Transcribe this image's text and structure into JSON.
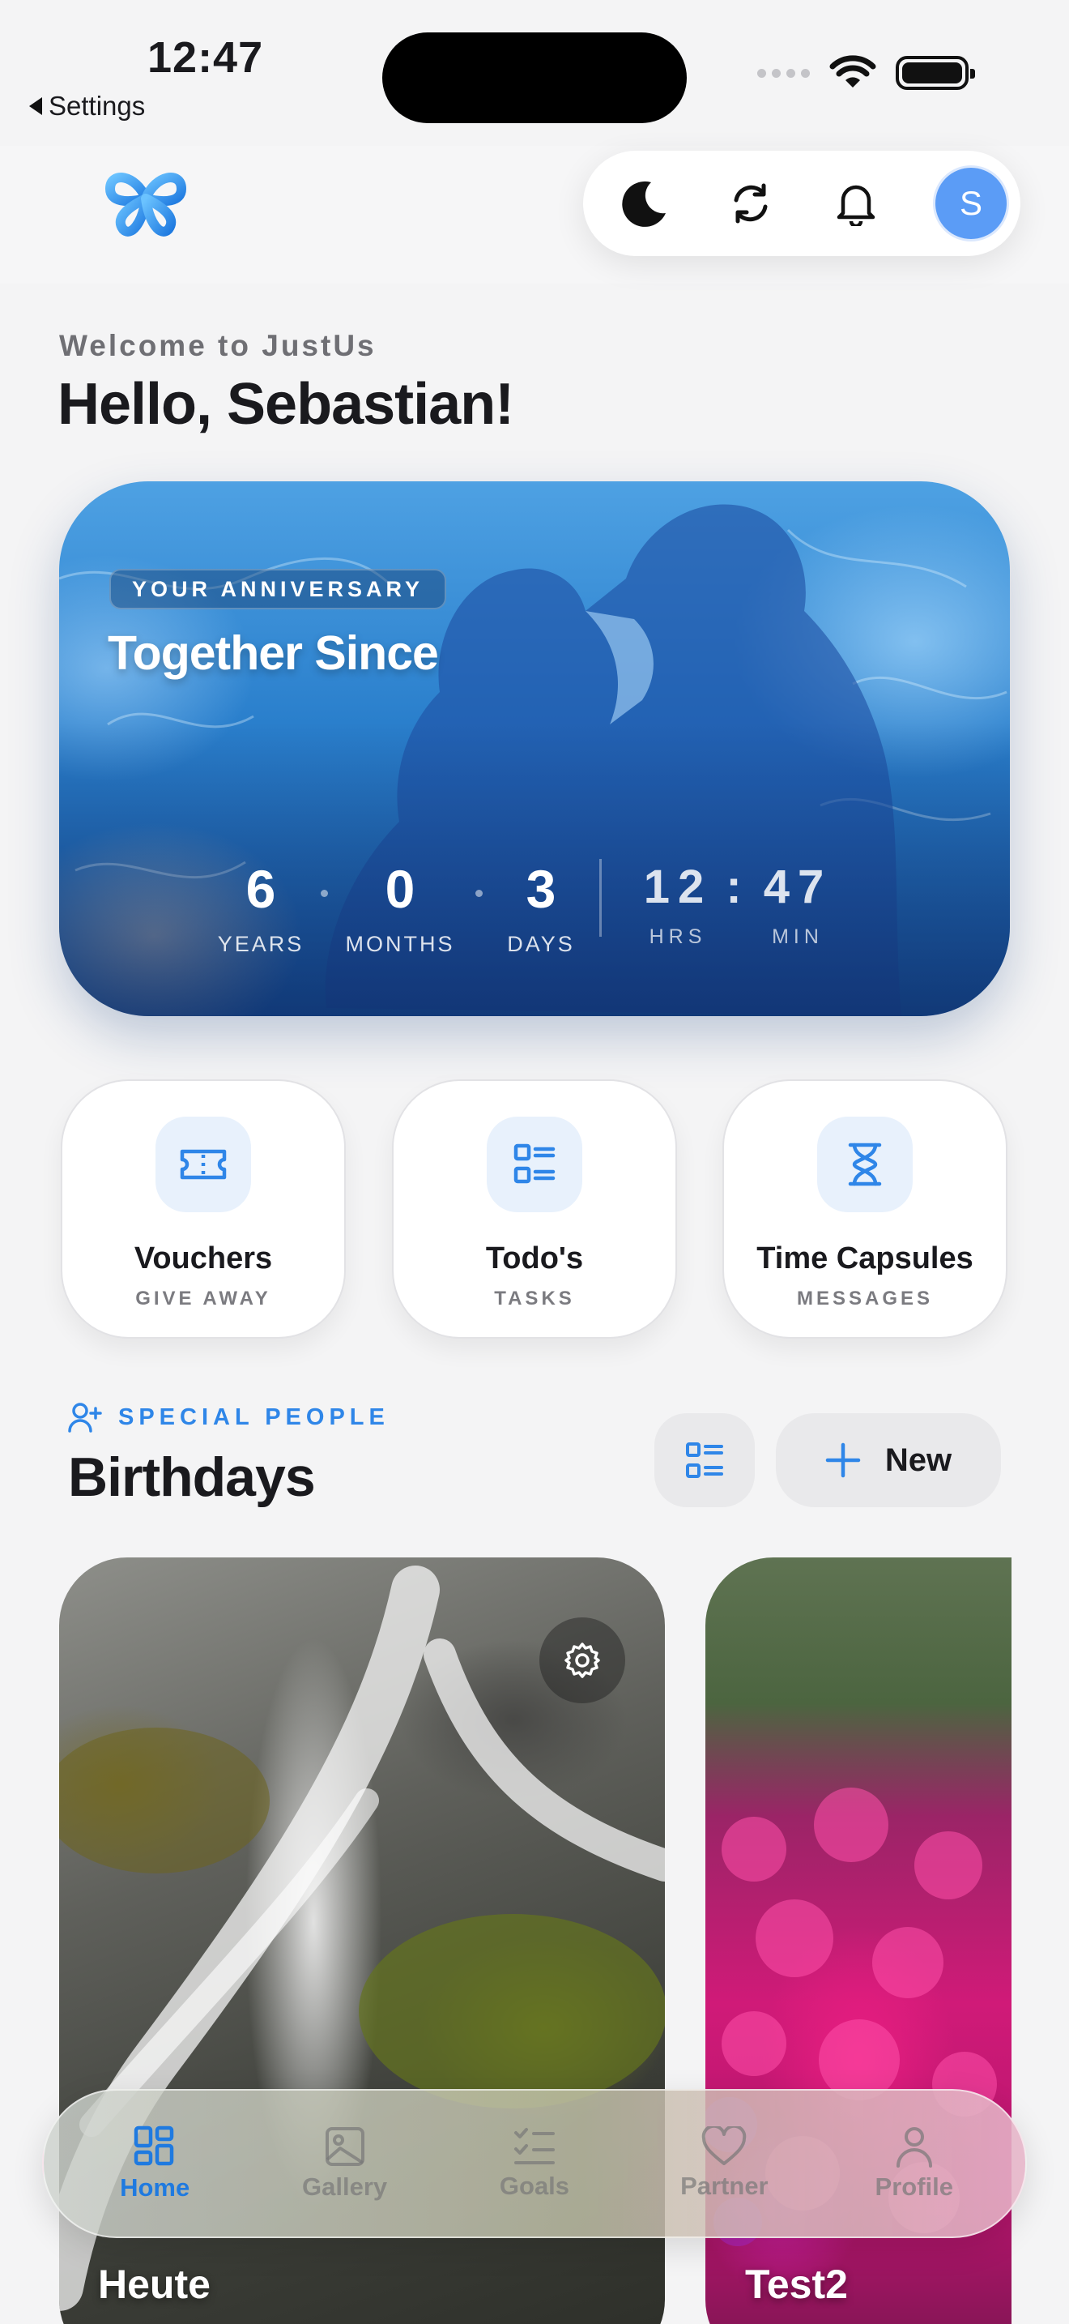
{
  "status_bar": {
    "time": "12:47",
    "back_label": "Settings"
  },
  "header": {
    "icons": [
      "dark-mode-icon",
      "refresh-icon",
      "bell-icon"
    ],
    "avatar_initial": "S"
  },
  "greeting": {
    "welcome": "Welcome to JustUs",
    "hello": "Hello, Sebastian!"
  },
  "anniversary": {
    "badge": "YOUR ANNIVERSARY",
    "title": "Together Since",
    "years": "6",
    "years_label": "YEARS",
    "months": "0",
    "months_label": "MONTHS",
    "days": "3",
    "days_label": "DAYS",
    "hours": "12",
    "hours_label": "HRS",
    "minutes": "47",
    "minutes_label": "MIN"
  },
  "quick_actions": [
    {
      "title": "Vouchers",
      "subtitle": "GIVE AWAY",
      "icon": "ticket-icon"
    },
    {
      "title": "Todo's",
      "subtitle": "TASKS",
      "icon": "checklist-icon"
    },
    {
      "title": "Time Capsules",
      "subtitle": "MESSAGES",
      "icon": "hourglass-icon"
    }
  ],
  "birthdays": {
    "section_label": "SPECIAL PEOPLE",
    "title": "Birthdays",
    "new_label": "New",
    "cards": [
      {
        "name": "Heute"
      },
      {
        "name": "Test2"
      }
    ]
  },
  "tabs": [
    {
      "label": "Home",
      "active": true
    },
    {
      "label": "Gallery",
      "active": false
    },
    {
      "label": "Goals",
      "active": false
    },
    {
      "label": "Partner",
      "active": false
    },
    {
      "label": "Profile",
      "active": false
    }
  ],
  "colors": {
    "accent": "#2F86E8",
    "avatar": "#5B9CF6"
  }
}
